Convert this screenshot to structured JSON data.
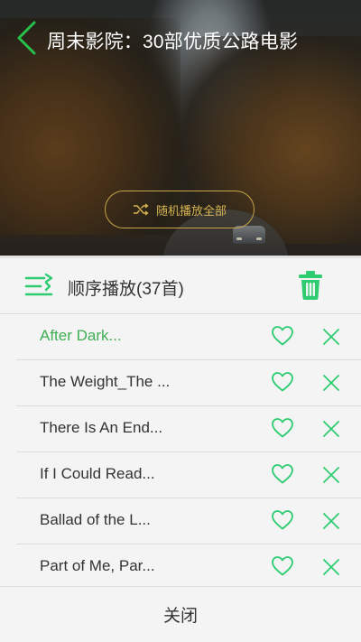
{
  "colors": {
    "accent": "#2ecc71",
    "active_title": "#3fae54",
    "gold": "#d6b451"
  },
  "header": {
    "title": "周末影院：30部优质公路电影",
    "back_icon": "chevron-left-icon"
  },
  "hero": {
    "shuffle_all_label": "随机播放全部",
    "shuffle_icon": "shuffle-icon"
  },
  "playlist": {
    "play_mode_icon": "list-order-icon",
    "mode_label": "顺序播放(37首)",
    "delete_icon": "trash-icon",
    "items": [
      {
        "title": "After Dark...",
        "active": true
      },
      {
        "title": "The Weight_The ...",
        "active": false
      },
      {
        "title": "There Is An End...",
        "active": false
      },
      {
        "title": "If I Could Read...",
        "active": false
      },
      {
        "title": "Ballad of the L...",
        "active": false
      },
      {
        "title": "Part of Me, Par...",
        "active": false
      }
    ]
  },
  "footer": {
    "close_label": "关闭"
  }
}
